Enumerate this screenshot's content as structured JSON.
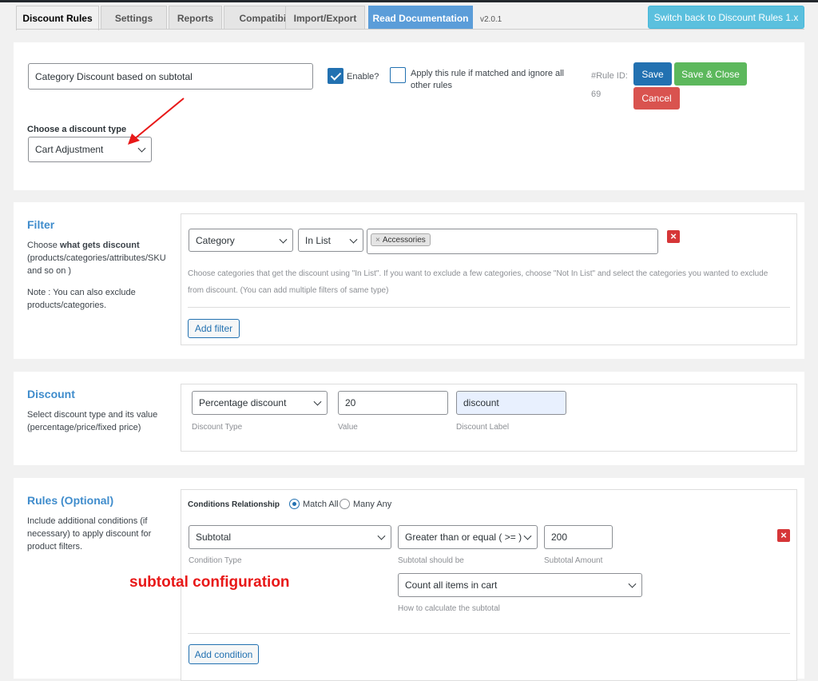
{
  "tabs": [
    {
      "label": "Discount Rules",
      "active": true
    },
    {
      "label": "Settings"
    },
    {
      "label": "Reports"
    },
    {
      "label": "Compatibility"
    },
    {
      "label": "Import/Export"
    },
    {
      "label": "Read Documentation"
    }
  ],
  "version": "v2.0.1",
  "switch_button": "Switch back to Discount Rules 1.x",
  "rule": {
    "title_value": "Category Discount based on subtotal",
    "enable_label": "Enable?",
    "enabled": true,
    "apply_only_label_line1": "Apply this rule if matched and ignore all",
    "apply_only_label_line2": "other rules",
    "rule_id_label": "#Rule ID:",
    "rule_id": "69",
    "save": "Save",
    "save_close": "Save & Close",
    "cancel": "Cancel",
    "discount_type_label": "Choose a discount type",
    "discount_type_value": "Cart Adjustment"
  },
  "filter": {
    "title": "Filter",
    "desc_prefix": "Choose ",
    "desc_bold": "what gets discount",
    "desc_rest": "(products/categories/attributes/SKU and so on )",
    "note": "Note : You can also exclude products/categories.",
    "type_value": "Category",
    "method_value": "In List",
    "tag": "Accessories",
    "hint_line1": "Choose categories that get the discount using \"In List\". If you want to exclude a few categories, choose \"Not In List\" and select the categories you wanted to exclude",
    "hint_line2": "from discount. (You can add multiple filters of same type)",
    "add_filter": "Add filter"
  },
  "discount": {
    "title": "Discount",
    "desc": "Select discount type and its value (percentage/price/fixed price)",
    "type_value": "Percentage discount",
    "type_caption": "Discount Type",
    "value": "20",
    "value_caption": "Value",
    "label_value": "discount",
    "label_caption": "Discount Label"
  },
  "rules": {
    "title": "Rules (Optional)",
    "desc": "Include additional conditions (if necessary) to apply discount for product filters.",
    "relationship_label": "Conditions Relationship",
    "match_all": "Match All",
    "many_any": "Many Any",
    "condition_type_value": "Subtotal",
    "condition_type_caption": "Condition Type",
    "operator_value": "Greater than or equal ( >= )",
    "operator_caption": "Subtotal should be",
    "amount_value": "200",
    "amount_caption": "Subtotal Amount",
    "calc_value": "Count all items in cart",
    "calc_caption": "How to calculate the subtotal",
    "add_condition": "Add condition"
  },
  "annotation": "subtotal configuration",
  "colors": {
    "accent": "#2271b1",
    "title": "#3f8ccc",
    "danger": "#d63638",
    "success": "#5cb85c",
    "annotation": "#e81818"
  }
}
